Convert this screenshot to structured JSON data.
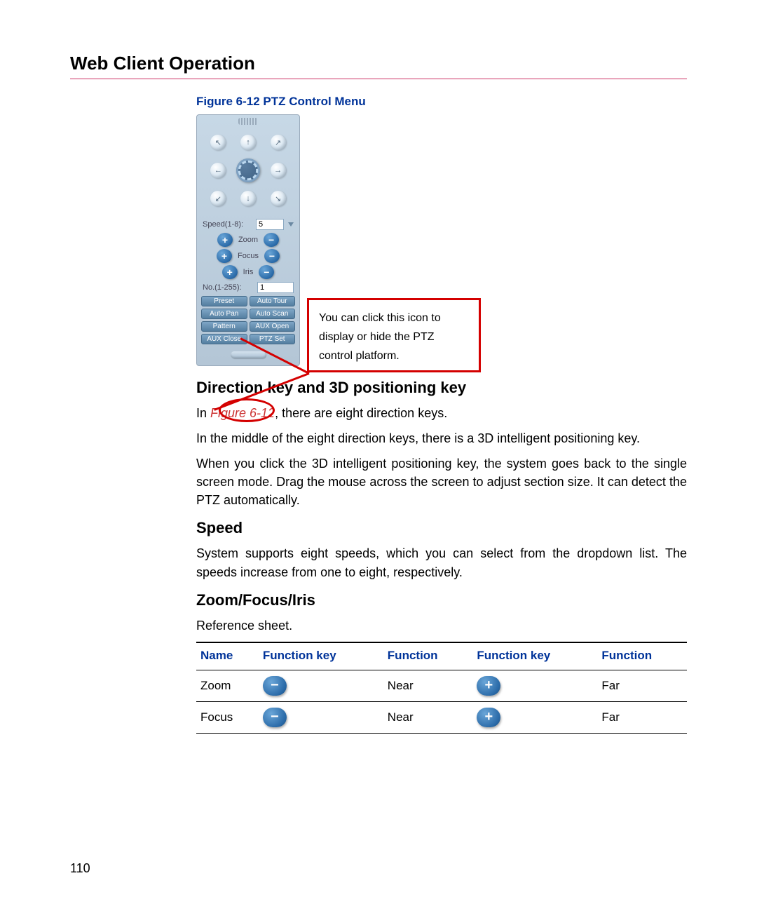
{
  "page": {
    "title": "Web Client Operation",
    "number": "110"
  },
  "figure": {
    "caption": "Figure 6-12 PTZ Control Menu",
    "ref_inline": "Figure 6-12"
  },
  "ptz": {
    "speed_label": "Speed(1-8):",
    "speed_value": "5",
    "zoom_label": "Zoom",
    "focus_label": "Focus",
    "iris_label": "Iris",
    "no_label": "No.(1-255):",
    "no_value": "1",
    "plus": "+",
    "minus": "−",
    "buttons": [
      "Preset",
      "Auto Tour",
      "Auto Pan",
      "Auto Scan",
      "Pattern",
      "AUX Open",
      "AUX Close",
      "PTZ Set"
    ]
  },
  "callout": {
    "text": "You can click this icon to display or hide the PTZ control platform."
  },
  "sections": {
    "dir_heading": "Direction key and 3D positioning key",
    "dir_p1_a": "In ",
    "dir_p1_b": ", there are eight direction keys.",
    "dir_p2": "In the middle of the eight direction keys, there is a 3D intelligent positioning key.",
    "dir_p3": "When you click the 3D intelligent positioning key, the system goes back to the single screen mode. Drag the mouse across the screen to adjust section size. It can detect the PTZ automatically.",
    "speed_heading": "Speed",
    "speed_p": "System supports eight speeds, which you can select from the dropdown list. The speeds increase from one to eight, respectively.",
    "zfi_heading": "Zoom/Focus/Iris",
    "zfi_p": "Reference sheet."
  },
  "table": {
    "headers": [
      "Name",
      "Function key",
      "Function",
      "Function key",
      "Function"
    ],
    "rows": [
      {
        "name": "Zoom",
        "k1": "−",
        "f1": "Near",
        "k2": "+",
        "f2": "Far"
      },
      {
        "name": "Focus",
        "k1": "−",
        "f1": "Near",
        "k2": "+",
        "f2": "Far"
      }
    ]
  }
}
